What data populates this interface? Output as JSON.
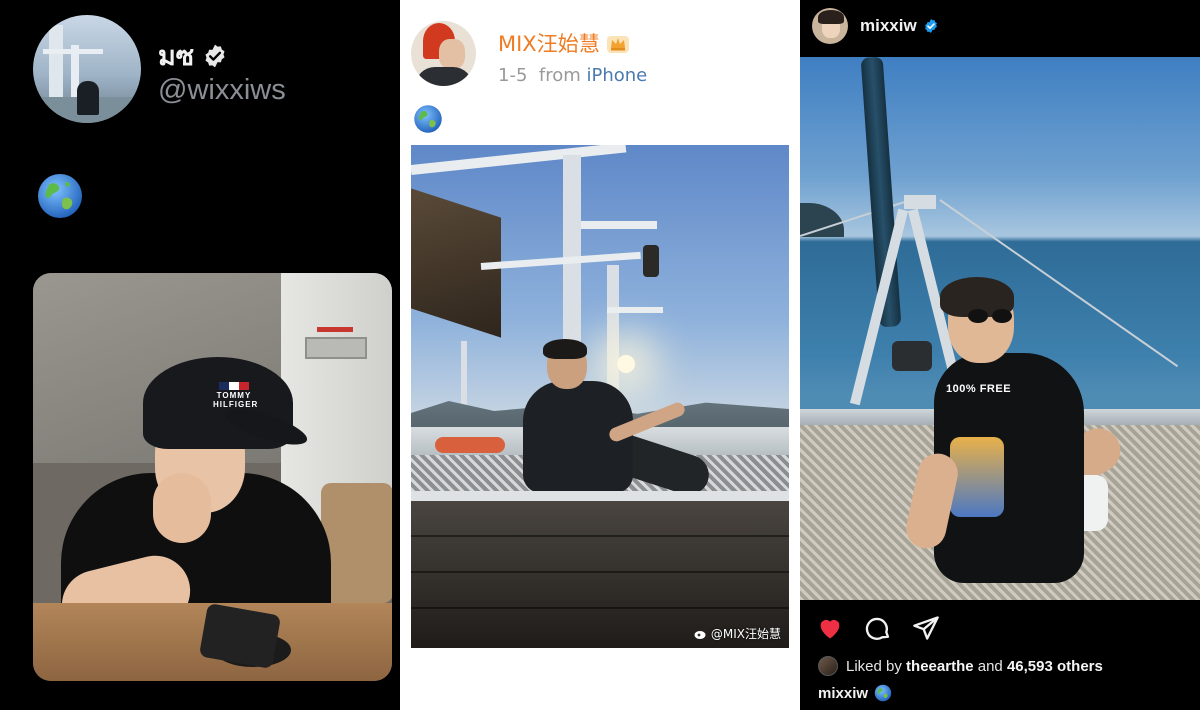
{
  "twitter_post": {
    "display_name": "มซ",
    "handle": "@wixxiws",
    "text_emoji": "globe-icon"
  },
  "weibo_post": {
    "username": "MIX汪始慧",
    "time": "1-5",
    "from_label": "from",
    "device": "iPhone",
    "text_emoji": "globe-icon",
    "watermark": "@MIX汪始慧"
  },
  "instagram_post": {
    "username": "mixxiw",
    "liked_by_prefix": "Liked by",
    "liked_by_user": "theearthe",
    "liked_by_connector": "and",
    "liked_by_others": "46,593 others",
    "caption_user": "mixxiw",
    "caption_emoji": "globe-icon",
    "photo_shirt_text": "100% FREE",
    "like_color": "#ef2f44"
  },
  "photo_texts": {
    "cap_logo": "TOMMY HILFIGER"
  },
  "colors": {
    "weibo_name": "#f07b22",
    "weibo_device": "#4a7ab0",
    "verified_blue": "#1d9bf0"
  }
}
